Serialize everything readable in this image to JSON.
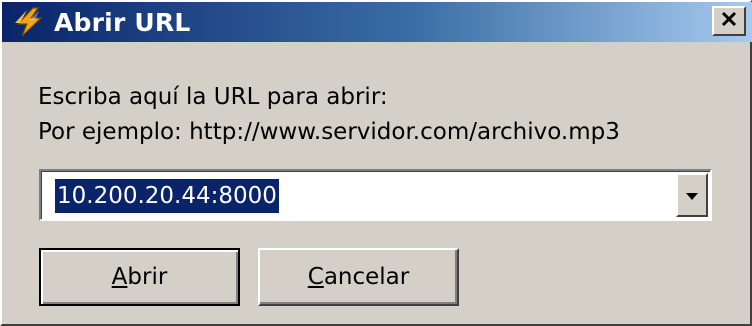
{
  "dialog": {
    "title": "Abrir URL",
    "app_icon": "lightning-bolt-icon",
    "close_icon": "close-icon",
    "close_glyph": "✕"
  },
  "prompt": {
    "line1": "Escriba aquí la URL para abrir:",
    "line2": "Por ejemplo: http://www.servidor.com/archivo.mp3"
  },
  "url_combo": {
    "value": "10.200.20.44:8000",
    "dropdown_icon": "chevron-down-icon"
  },
  "buttons": {
    "open_first": "A",
    "open_rest": "brir",
    "cancel_first": "C",
    "cancel_rest": "ancelar"
  },
  "colors": {
    "title_gradient_start": "#0a246a",
    "title_gradient_end": "#a6caf0",
    "face": "#d4d0c8",
    "selection": "#0a246a"
  }
}
